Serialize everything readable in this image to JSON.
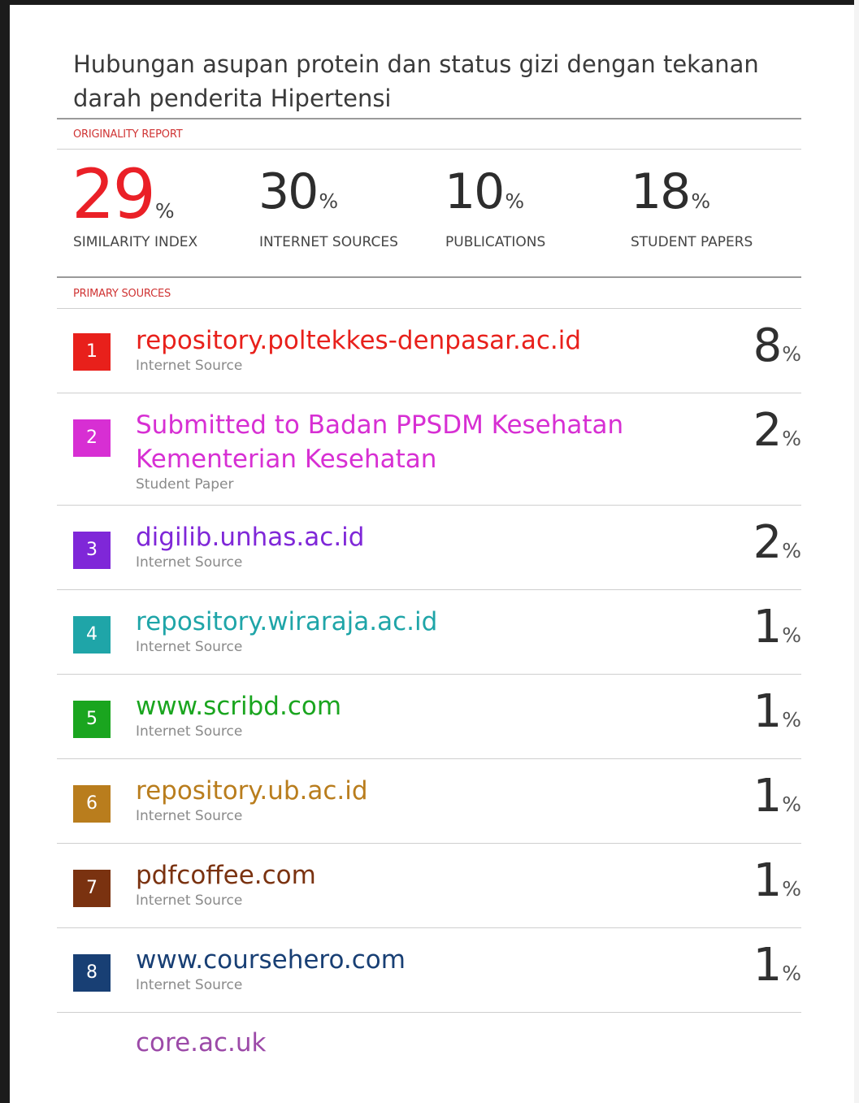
{
  "document": {
    "title": "Hubungan asupan protein dan status gizi dengan tekanan darah penderita Hipertensi",
    "originality_label": "ORIGINALITY REPORT",
    "primary_sources_label": "PRIMARY SOURCES"
  },
  "stats": [
    {
      "value": "29",
      "unit": "%",
      "label": "SIMILARITY INDEX",
      "color": "#ea2027"
    },
    {
      "value": "30",
      "unit": "%",
      "label": "INTERNET SOURCES"
    },
    {
      "value": "10",
      "unit": "%",
      "label": "PUBLICATIONS"
    },
    {
      "value": "18",
      "unit": "%",
      "label": "STUDENT PAPERS"
    }
  ],
  "sources": [
    {
      "rank": "1",
      "name": "repository.poltekkes-denpasar.ac.id",
      "type": "Internet Source",
      "percent": "8",
      "unit": "%",
      "color": "#e8201b"
    },
    {
      "rank": "2",
      "name_line1": "Submitted to Badan PPSDM Kesehatan",
      "name_line2": "Kementerian Kesehatan",
      "type": "Student Paper",
      "percent": "2",
      "unit": "%",
      "color": "#d72fd3"
    },
    {
      "rank": "3",
      "name": "digilib.unhas.ac.id",
      "type": "Internet Source",
      "percent": "2",
      "unit": "%",
      "color": "#7f27d8"
    },
    {
      "rank": "4",
      "name": "repository.wiraraja.ac.id",
      "type": "Internet Source",
      "percent": "1",
      "unit": "%",
      "color": "#1fa5a8"
    },
    {
      "rank": "5",
      "name": "www.scribd.com",
      "type": "Internet Source",
      "percent": "1",
      "unit": "%",
      "color": "#1aa51f"
    },
    {
      "rank": "6",
      "name": "repository.ub.ac.id",
      "type": "Internet Source",
      "percent": "1",
      "unit": "%",
      "color": "#b97d1d"
    },
    {
      "rank": "7",
      "name": "pdfcoffee.com",
      "type": "Internet Source",
      "percent": "1",
      "unit": "%",
      "color": "#7a3210"
    },
    {
      "rank": "8",
      "name": "www.coursehero.com",
      "type": "Internet Source",
      "percent": "1",
      "unit": "%",
      "color": "#183f74"
    }
  ],
  "partial_source": {
    "name": "core.ac.uk"
  }
}
